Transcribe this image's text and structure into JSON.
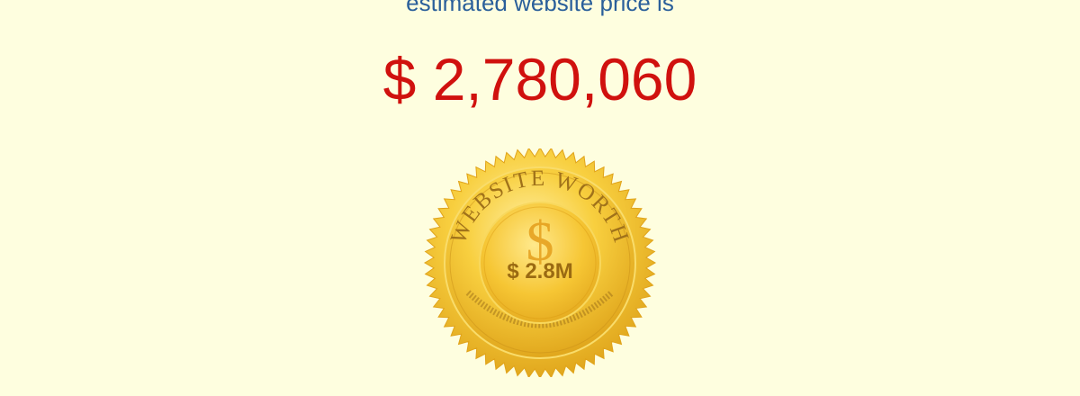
{
  "estimate": {
    "label": "estimated website price is",
    "price": "$ 2,780,060"
  },
  "seal": {
    "arc_text": "WEBSITE WORTH",
    "currency_symbol": "$",
    "value": "$ 2.8M",
    "colors": {
      "gold_light": "#fde37a",
      "gold": "#f5c02b",
      "gold_dark": "#d99a12",
      "engraving": "#9a6a12"
    }
  },
  "colors": {
    "background": "#fefedf",
    "label": "#2a5f9a",
    "price": "#d0110e"
  }
}
